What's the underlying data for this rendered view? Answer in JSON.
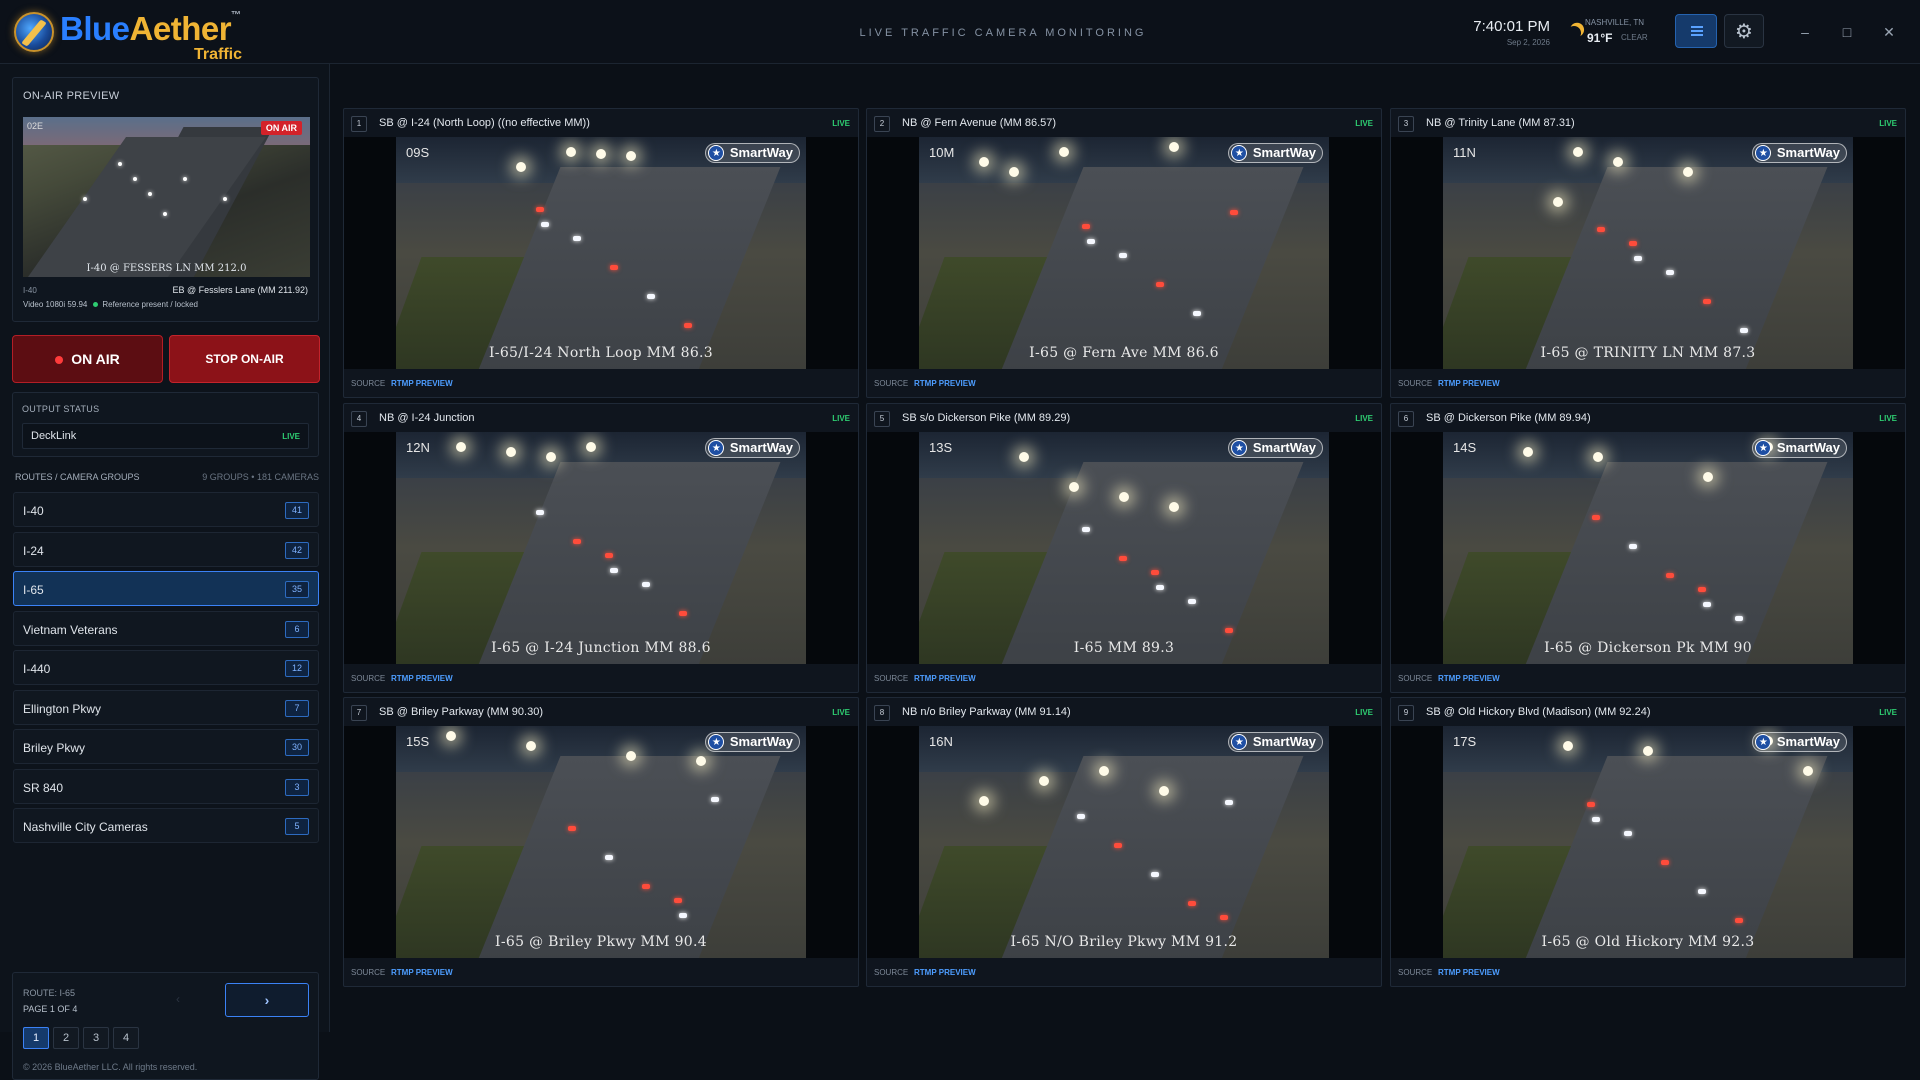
{
  "header": {
    "logo_blue": "Blue",
    "logo_gold": "Aether",
    "logo_tm": "™",
    "logo_sub": "Traffic",
    "title": "LIVE TRAFFIC CAMERA MONITORING",
    "time": "7:40:01 PM",
    "date": "Sep 2, 2026",
    "weather_city": "NASHVILLE, TN",
    "weather_temp": "91°F",
    "weather_cond": "CLEAR",
    "minimize": "–",
    "maximize": "□",
    "close": "✕"
  },
  "preview": {
    "title": "ON-AIR PREVIEW",
    "badge": "ON AIR",
    "overlay_text": "I-40 @ FESSERS LN MM 212.0",
    "cam_id": "02E",
    "route": "I-40",
    "location": "EB @ Fesslers Lane (MM 211.92)",
    "video_info": "Video 1080i 59.94",
    "reference": "Reference present / locked"
  },
  "controls": {
    "on_air": "ON AIR",
    "stop_on_air": "STOP ON-AIR"
  },
  "output": {
    "title": "OUTPUT STATUS",
    "device": "DeckLink",
    "state": "LIVE"
  },
  "routes": {
    "title": "ROUTES / CAMERA GROUPS",
    "summary": "9 GROUPS • 181 CAMERAS",
    "items": [
      {
        "label": "I-40",
        "count": "41"
      },
      {
        "label": "I-24",
        "count": "42"
      },
      {
        "label": "I-65",
        "count": "35"
      },
      {
        "label": "Vietnam Veterans",
        "count": "6"
      },
      {
        "label": "I-440",
        "count": "12"
      },
      {
        "label": "Ellington Pkwy",
        "count": "7"
      },
      {
        "label": "Briley Pkwy",
        "count": "30"
      },
      {
        "label": "SR 840",
        "count": "3"
      },
      {
        "label": "Nashville City Cameras",
        "count": "5"
      }
    ]
  },
  "pager": {
    "route": "ROUTE: I-65",
    "page": "PAGE 1 OF 4",
    "prev": "‹",
    "next": "›",
    "pages": [
      "1",
      "2",
      "3",
      "4"
    ],
    "copyright": "© 2026 BlueAether LLC. All rights reserved."
  },
  "cameras": [
    {
      "num": "1",
      "title": "SB @ I-24 (North Loop) ((no effective MM))",
      "live": "LIVE",
      "cam_id": "09S",
      "caption": "I-65/I-24 North Loop MM 86.3",
      "source": "SOURCE",
      "preview": "RTMP PREVIEW"
    },
    {
      "num": "2",
      "title": "NB @ Fern Avenue (MM 86.57)",
      "live": "LIVE",
      "cam_id": "10M",
      "caption": "I-65 @ Fern Ave MM 86.6",
      "source": "SOURCE",
      "preview": "RTMP PREVIEW"
    },
    {
      "num": "3",
      "title": "NB @ Trinity Lane (MM 87.31)",
      "live": "LIVE",
      "cam_id": "11N",
      "caption": "I-65 @ TRINITY LN MM 87.3",
      "source": "SOURCE",
      "preview": "RTMP PREVIEW"
    },
    {
      "num": "4",
      "title": "NB @ I-24 Junction",
      "live": "LIVE",
      "cam_id": "12N",
      "caption": "I-65 @ I-24 Junction MM 88.6",
      "source": "SOURCE",
      "preview": "RTMP PREVIEW"
    },
    {
      "num": "5",
      "title": "SB s/o Dickerson Pike (MM 89.29)",
      "live": "LIVE",
      "cam_id": "13S",
      "caption": "I-65 MM 89.3",
      "source": "SOURCE",
      "preview": "RTMP PREVIEW"
    },
    {
      "num": "6",
      "title": "SB @ Dickerson Pike (MM 89.94)",
      "live": "LIVE",
      "cam_id": "14S",
      "caption": "I-65 @ Dickerson Pk  MM 90",
      "source": "SOURCE",
      "preview": "RTMP PREVIEW"
    },
    {
      "num": "7",
      "title": "SB @ Briley Parkway (MM 90.30)",
      "live": "LIVE",
      "cam_id": "15S",
      "caption": "I-65 @ Briley Pkwy MM 90.4",
      "source": "SOURCE",
      "preview": "RTMP PREVIEW"
    },
    {
      "num": "8",
      "title": "NB n/o Briley Parkway (MM 91.14)",
      "live": "LIVE",
      "cam_id": "16N",
      "caption": "I-65 N/O Briley Pkwy MM 91.2",
      "source": "SOURCE",
      "preview": "RTMP PREVIEW"
    },
    {
      "num": "9",
      "title": "SB @ Old Hickory Blvd (Madison) (MM 92.24)",
      "live": "LIVE",
      "cam_id": "17S",
      "caption": "I-65 @ Old Hickory MM 92.3",
      "source": "SOURCE",
      "preview": "RTMP PREVIEW"
    }
  ],
  "watermark": "SmartWay"
}
